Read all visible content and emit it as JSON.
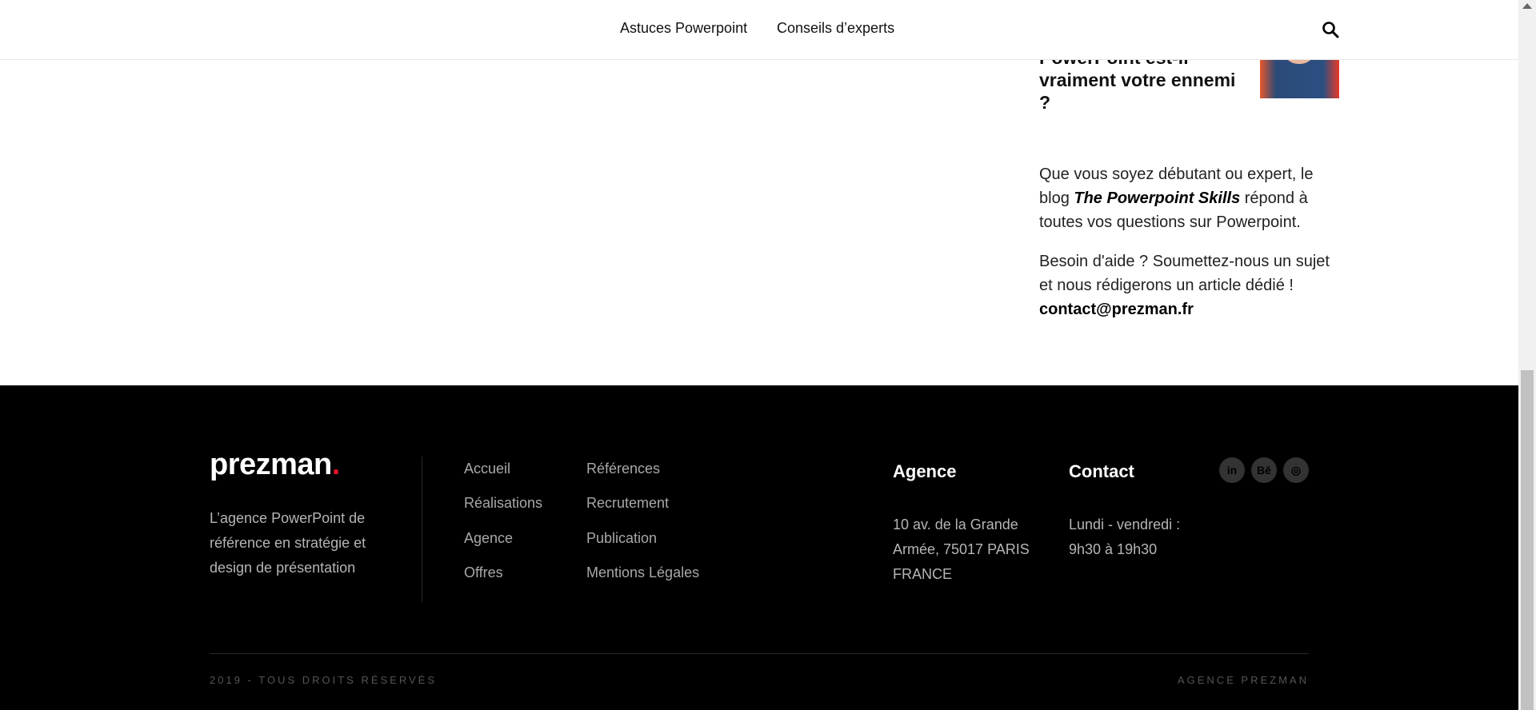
{
  "header": {
    "nav": [
      "Astuces Powerpoint",
      "Conseils d’experts"
    ],
    "search_icon": "search-icon"
  },
  "sidebar": {
    "article_title_lines": [
      "PowerPoint est-il",
      "vraiment votre ennemi",
      "?"
    ],
    "intro": {
      "before": "Que vous soyez débutant ou expert, le blog ",
      "emphasis": "The Powerpoint Skills",
      "after": " répond à toutes vos questions sur Powerpoint."
    },
    "help": {
      "before": "Besoin d'aide ? Soumettez-nous un sujet et nous rédigerons un article dédié ! ",
      "email": "contact@prezman.fr"
    }
  },
  "footer": {
    "logo": "prezman",
    "logo_dot": ".",
    "brand_accent": "#e8112d",
    "tagline": "L’agence PowerPoint de référence en stratégie et design de présentation",
    "links_col1": [
      "Accueil",
      "Réalisations",
      "Agence",
      "Offres"
    ],
    "links_col2": [
      "Références",
      "Recrutement",
      "Publication",
      "Mentions Légales"
    ],
    "agence": {
      "title": "Agence",
      "address": "10 av. de la Grande Armée, 75017 PARIS FRANCE"
    },
    "contact": {
      "title": "Contact",
      "hours": "Lundi - vendredi : 9h30 à 19h30"
    },
    "social": [
      {
        "icon": "linkedin-icon",
        "label": "in"
      },
      {
        "icon": "behance-icon",
        "label": "Bē"
      },
      {
        "icon": "dribbble-icon",
        "label": "◎"
      }
    ],
    "copyright": "2019 - TOUS DROITS RÉSERVÉS",
    "signature": "AGENCE PREZMAN"
  }
}
